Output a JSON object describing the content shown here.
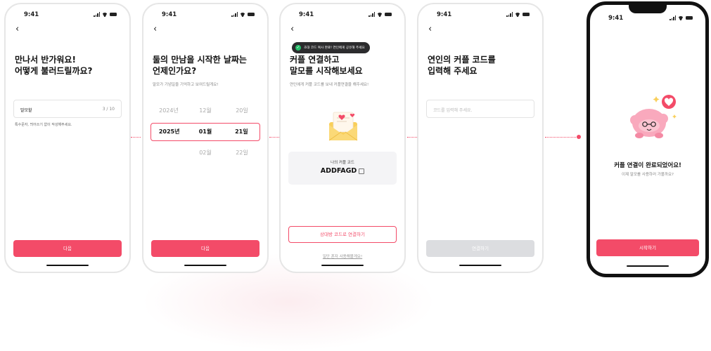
{
  "colors": {
    "accent": "#f34b68",
    "disabled": "#dcdde0"
  },
  "status_time": "9:41",
  "screens": {
    "nickname": {
      "title_line1": "만나서 반가워요!",
      "title_line2": "어떻게 불러드릴까요?",
      "input_value": "말모할",
      "counter": "3 / 10",
      "note": "특수문자, 띄어쓰기 없이 작성해주세요.",
      "button": "다음"
    },
    "date": {
      "title_line1": "둘의 만남을 시작한 날짜는",
      "title_line2": "언제인가요?",
      "subtitle": "말모가 기념일을 기억하고 보여드릴게요!",
      "rows": [
        {
          "year": "2024년",
          "month": "12월",
          "day": "20일"
        },
        {
          "year": "2025년",
          "month": "01월",
          "day": "21일"
        },
        {
          "year": "",
          "month": "02월",
          "day": "22일"
        }
      ],
      "button": "다음"
    },
    "connect": {
      "toast": "초대 코드 복사 완료! 연인에게 공유해 주세요",
      "title_line1": "커플 연결하고",
      "title_line2": "말모를 시작해보세요",
      "subtitle": "연인에게 커플 코드를 보내 커플연결을 해주세요!",
      "code_label": "나의 커플 코드",
      "code_value": "ADDFAGD",
      "button": "상대방 코드로 연결하기",
      "skip": "일단 혼자 사용해볼게요!"
    },
    "enter": {
      "title_line1": "연인의 커플 코드를",
      "title_line2": "입력해 주세요",
      "placeholder": "코드를 입력해 주세요.",
      "button": "연결하기"
    },
    "done": {
      "title": "커플 연결이 완료되었어요!",
      "subtitle": "이제 말모를 사용하러 가볼까요?",
      "button": "시작하기"
    }
  }
}
